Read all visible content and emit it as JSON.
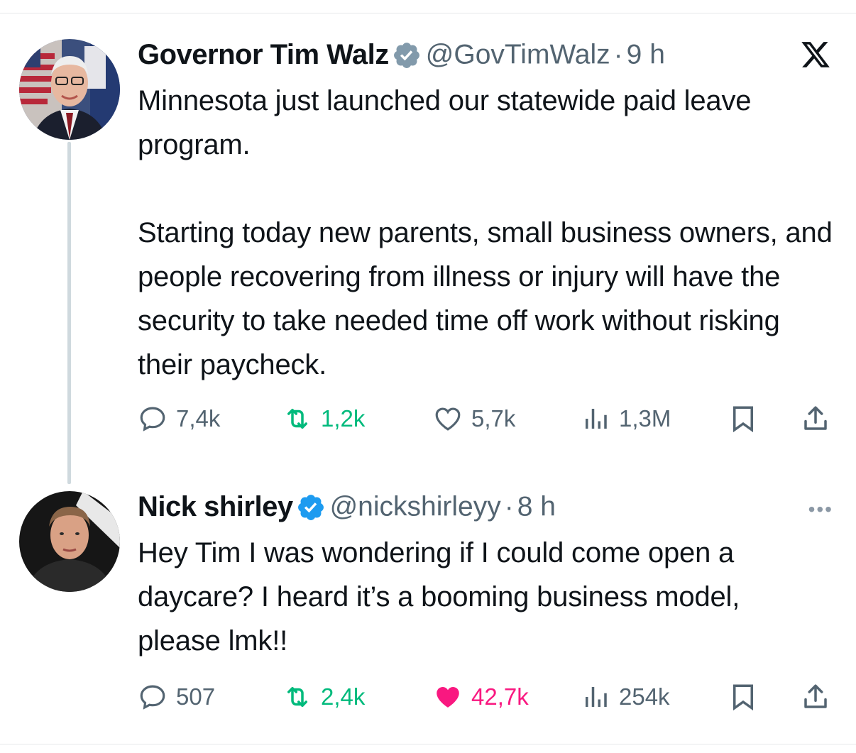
{
  "tweets": [
    {
      "name": "Governor Tim Walz",
      "handle": "@GovTimWalz",
      "separator": "·",
      "time": "9 h",
      "paragraphs": [
        "Minnesota just launched our statewide paid leave program.",
        "Starting today new parents, small business owners, and people recovering from illness or injury will have the security to take needed time off work without risking their paycheck."
      ],
      "replies": "7,4k",
      "reposts": "1,2k",
      "likes": "5,7k",
      "views": "1,3M",
      "verified_color": "#829aab",
      "liked": false
    },
    {
      "name": "Nick shirley",
      "handle": "@nickshirleyy",
      "separator": "·",
      "time": "8 h",
      "paragraphs": [
        "Hey Tim I was wondering if I could come open a daycare? I heard it’s a booming business model, please lmk!!"
      ],
      "replies": "507",
      "reposts": "2,4k",
      "likes": "42,7k",
      "views": "254k",
      "verified_color": "#1d9bf0",
      "liked": true
    }
  ],
  "more_label": "•••",
  "icons": {
    "brand": "x-logo-icon",
    "reply": "reply-icon",
    "repost": "repost-icon",
    "like": "heart-icon",
    "views": "views-chart-icon",
    "bookmark": "bookmark-icon",
    "share": "share-icon",
    "verified": "verified-badge-icon",
    "more": "more-options-icon"
  },
  "colors": {
    "text": "#0f1419",
    "muted": "#536471",
    "repost_green": "#00ba7c",
    "like_pink": "#f91880",
    "divider": "#cfd9de"
  }
}
